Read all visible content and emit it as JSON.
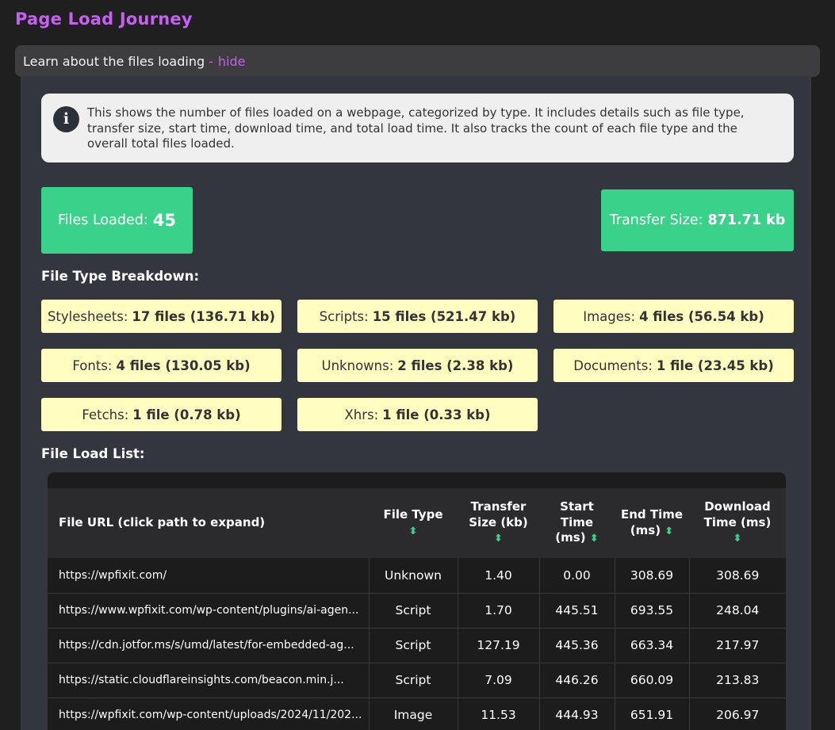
{
  "title": "Page Load Journey",
  "learn_bar": {
    "text": "Learn about the files loading",
    "dash": "-",
    "hide_label": "hide"
  },
  "info": {
    "icon": "info-icon",
    "icon_glyph": "i",
    "text": "This shows the number of files loaded on a webpage, categorized by type. It includes details such as file type, transfer size, start time, download time, and total load time. It also tracks the count of each file type and the overall total files loaded."
  },
  "stats": {
    "files_loaded_label": "Files Loaded:",
    "files_loaded_value": "45",
    "transfer_size_label": "Transfer Size:",
    "transfer_size_value": "871.71 kb"
  },
  "breakdown": {
    "heading": "File Type Breakdown:",
    "items": [
      {
        "label": "Stylesheets:",
        "value": "17 files (136.71 kb)"
      },
      {
        "label": "Scripts:",
        "value": "15 files (521.47 kb)"
      },
      {
        "label": "Images:",
        "value": "4 files (56.54 kb)"
      },
      {
        "label": "Fonts:",
        "value": "4 files (130.05 kb)"
      },
      {
        "label": "Unknowns:",
        "value": "2 files (2.38 kb)"
      },
      {
        "label": "Documents:",
        "value": "1 file (23.45 kb)"
      },
      {
        "label": "Fetchs:",
        "value": "1 file (0.78 kb)"
      },
      {
        "label": "Xhrs:",
        "value": "1 file (0.33 kb)"
      }
    ]
  },
  "list": {
    "heading": "File Load List:",
    "columns": {
      "url": "File URL (click path to expand)",
      "type": "File Type",
      "size": "Transfer Size (kb)",
      "start": "Start Time (ms)",
      "end": "End Time (ms)",
      "download": "Download Time (ms)",
      "sort_icon": "sort-arrows-icon",
      "sort_glyph": "⬍"
    },
    "rows": [
      {
        "url": "https://wpfixit.com/",
        "type": "Unknown",
        "size": "1.40",
        "start": "0.00",
        "end": "308.69",
        "download": "308.69"
      },
      {
        "url": "https://www.wpfixit.com/wp-content/plugins/ai-agen...",
        "type": "Script",
        "size": "1.70",
        "start": "445.51",
        "end": "693.55",
        "download": "248.04"
      },
      {
        "url": "https://cdn.jotfor.ms/s/umd/latest/for-embedded-ag...",
        "type": "Script",
        "size": "127.19",
        "start": "445.36",
        "end": "663.34",
        "download": "217.97"
      },
      {
        "url": "https://static.cloudflareinsights.com/beacon.min.j...",
        "type": "Script",
        "size": "7.09",
        "start": "446.26",
        "end": "660.09",
        "download": "213.83"
      },
      {
        "url": "https://wpfixit.com/wp-content/uploads/2024/11/202...",
        "type": "Image",
        "size": "11.53",
        "start": "444.93",
        "end": "651.91",
        "download": "206.97"
      }
    ]
  },
  "colors": {
    "accent": "#c65ff2",
    "stat_green": "#3ad28a",
    "card_yellow": "#fffdc0"
  }
}
